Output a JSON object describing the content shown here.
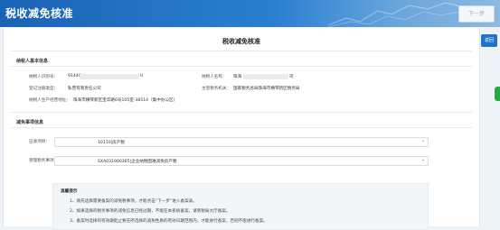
{
  "header": {
    "title": "税收减免核准",
    "next_label": "下一步"
  },
  "side": {
    "back_label": "返回"
  },
  "page": {
    "title": "税收减免核准"
  },
  "basic_info": {
    "section_title": "纳税人基本信息",
    "taxpayer_id_label": "纳税人识别号：",
    "taxpayer_id_prefix": "91440",
    "taxpayer_id_suffix": "U",
    "taxpayer_name_label": "纳税人名称：",
    "taxpayer_name_prefix": "珠海",
    "taxpayer_name_suffix": "司",
    "reg_type_label": "登记注册类型：",
    "reg_type_value": "私营有限责任公司",
    "authority_label": "主管税务机关：",
    "authority_value": "国家税务总局珠海市横琴新区税务局",
    "address_label": "纳税人生产经营地址：",
    "address_value": "珠海市横琴新区宝华路6号105室-38514（集中办公区）"
  },
  "reduction_info": {
    "section_title": "减免事项信息",
    "tax_item_label": "征收项目：",
    "tax_item_value": "10110|房产税",
    "matter_label": "受理税务事项：",
    "matter_value": "SXA031900365|企业纳税困难减免房产税"
  },
  "tips": {
    "title": "温馨提示",
    "items": [
      "1、请先选择需要备案的减免税事项，才能点击“下一步”进入备案表。",
      "2、如果选择的税务事项的减免信息已经过期，不能在本系统备案，请到税局大厅备案。",
      "3、备案时选择的有效期起止要在所选择的减免性质的有效日期范围内，才能进行备案，否则不能进行备案。"
    ]
  }
}
